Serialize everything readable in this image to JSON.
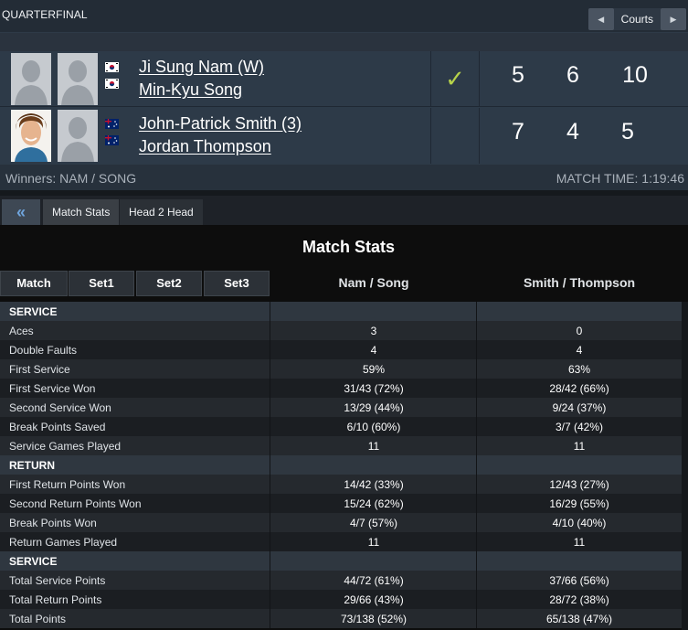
{
  "header": {
    "round": "QUARTERFINAL",
    "courts_label": "Courts"
  },
  "teams": [
    {
      "players": [
        "Ji Sung Nam (W)",
        "Min-Kyu Song"
      ],
      "flag": "south-korea",
      "winner": true,
      "scores": [
        "5",
        "6",
        "10"
      ]
    },
    {
      "players": [
        "John-Patrick Smith (3)",
        "Jordan Thompson"
      ],
      "flag": "australia",
      "winner": false,
      "scores": [
        "7",
        "4",
        "5"
      ]
    }
  ],
  "check_icon": "✓",
  "info": {
    "winners": "Winners: NAM / SONG",
    "match_time": "MATCH TIME: 1:19:46"
  },
  "tabs": {
    "back_icon": "«",
    "active": "Match Stats",
    "other": "Head 2 Head"
  },
  "stats_panel": {
    "title": "Match Stats",
    "set_tabs": [
      "Match",
      "Set1",
      "Set2",
      "Set3"
    ],
    "col1": "Nam / Song",
    "col2": "Smith / Thompson",
    "rows": [
      {
        "section": true,
        "label": "SERVICE"
      },
      {
        "label": "Aces",
        "v1": "3",
        "v2": "0"
      },
      {
        "label": "Double Faults",
        "v1": "4",
        "v2": "4"
      },
      {
        "label": "First Service",
        "v1": "59%",
        "v2": "63%"
      },
      {
        "label": "First Service Won",
        "v1": "31/43 (72%)",
        "v2": "28/42 (66%)"
      },
      {
        "label": "Second Service Won",
        "v1": "13/29 (44%)",
        "v2": "9/24 (37%)"
      },
      {
        "label": "Break Points Saved",
        "v1": "6/10 (60%)",
        "v2": "3/7 (42%)"
      },
      {
        "label": "Service Games Played",
        "v1": "11",
        "v2": "11"
      },
      {
        "section": true,
        "label": "RETURN"
      },
      {
        "label": "First Return Points Won",
        "v1": "14/42 (33%)",
        "v2": "12/43 (27%)"
      },
      {
        "label": "Second Return Points Won",
        "v1": "15/24 (62%)",
        "v2": "16/29 (55%)"
      },
      {
        "label": "Break Points Won",
        "v1": "4/7 (57%)",
        "v2": "4/10 (40%)"
      },
      {
        "label": "Return Games Played",
        "v1": "11",
        "v2": "11"
      },
      {
        "section": true,
        "label": "SERVICE"
      },
      {
        "label": "Total Service Points",
        "v1": "44/72 (61%)",
        "v2": "37/66 (56%)"
      },
      {
        "label": "Total Return Points",
        "v1": "29/66 (43%)",
        "v2": "28/72 (38%)"
      },
      {
        "label": "Total Points",
        "v1": "73/138 (52%)",
        "v2": "65/138 (47%)"
      }
    ]
  }
}
